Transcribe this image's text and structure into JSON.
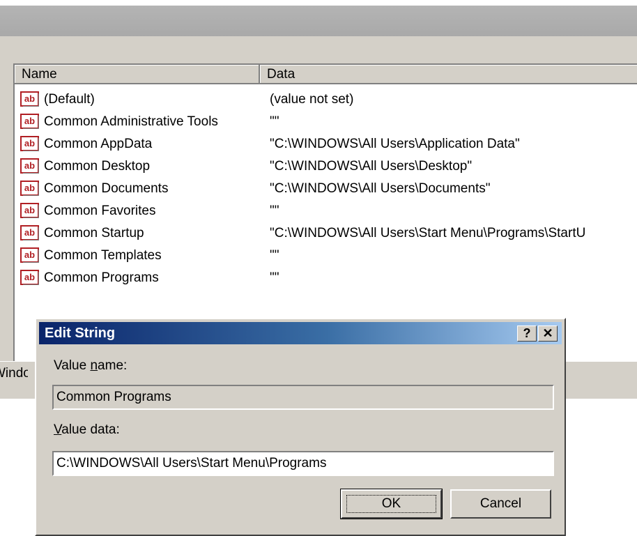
{
  "registry": {
    "columns": {
      "name": "Name",
      "data": "Data"
    },
    "rows": [
      {
        "name": "(Default)",
        "data": "(value not set)"
      },
      {
        "name": "Common Administrative Tools",
        "data": "\"\""
      },
      {
        "name": "Common AppData",
        "data": "\"C:\\WINDOWS\\All Users\\Application Data\""
      },
      {
        "name": "Common Desktop",
        "data": "\"C:\\WINDOWS\\All Users\\Desktop\""
      },
      {
        "name": "Common Documents",
        "data": "\"C:\\WINDOWS\\All Users\\Documents\""
      },
      {
        "name": "Common Favorites",
        "data": "\"\""
      },
      {
        "name": "Common Startup",
        "data": "\"C:\\WINDOWS\\All Users\\Start Menu\\Programs\\StartU"
      },
      {
        "name": "Common Templates",
        "data": "\"\""
      },
      {
        "name": "Common Programs",
        "data": "\"\""
      }
    ],
    "icon": "string-value-icon",
    "icon_glyph": "ab"
  },
  "status": {
    "text": "Windows"
  },
  "dialog": {
    "title": "Edit String",
    "help_glyph": "?",
    "close_glyph": "✕",
    "value_name_label_pre": "Value ",
    "value_name_label_key": "n",
    "value_name_label_post": "ame:",
    "value_name": "Common Programs",
    "value_data_label_key": "V",
    "value_data_label_post": "alue data:",
    "value_data": "C:\\WINDOWS\\All Users\\Start Menu\\Programs",
    "ok_label": "OK",
    "cancel_label": "Cancel"
  },
  "colors": {
    "title_start": "#0a246a",
    "title_end": "#a6caf0",
    "face": "#d4d0c8",
    "icon_red": "#b11f24"
  }
}
